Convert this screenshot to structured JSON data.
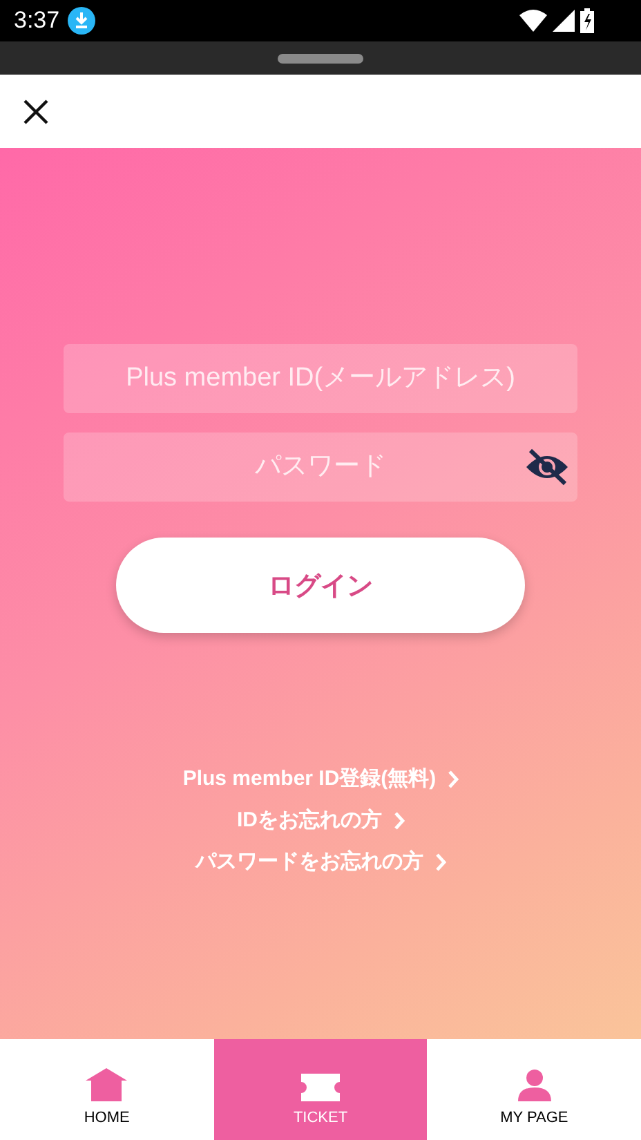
{
  "status_bar": {
    "time": "3:37"
  },
  "login_form": {
    "id_field": {
      "placeholder": "Plus member ID(メールアドレス)"
    },
    "password_field": {
      "placeholder": "パスワード",
      "password_visible": false
    },
    "login_button": "ログイン"
  },
  "links": [
    {
      "label": "Plus member ID登録(無料)"
    },
    {
      "label": "IDをお忘れの方"
    },
    {
      "label": "パスワードをお忘れの方"
    }
  ],
  "bottom_nav": [
    {
      "kind": "home",
      "label": "HOME",
      "selected": false
    },
    {
      "kind": "ticket",
      "label": "TICKET",
      "selected": true
    },
    {
      "kind": "mypage",
      "label": "MY PAGE",
      "selected": false
    }
  ]
}
